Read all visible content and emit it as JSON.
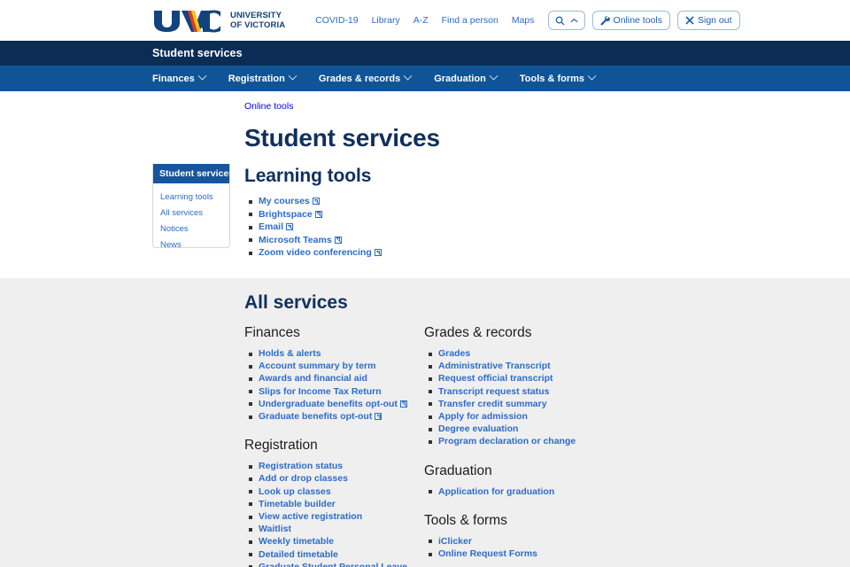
{
  "header": {
    "logo_text": "UVIC",
    "wordmark_line1": "UNIVERSITY",
    "wordmark_line2": "OF VICTORIA",
    "util_links": [
      {
        "label": "COVID-19"
      },
      {
        "label": "Library"
      },
      {
        "label": "A-Z"
      },
      {
        "label": "Find a person"
      },
      {
        "label": "Maps"
      }
    ],
    "search_button": {
      "icon": "search-icon",
      "chevron": "chevron-up-icon"
    },
    "online_tools_button": {
      "label": "Online tools",
      "icon": "wrench-icon"
    },
    "sign_out_button": {
      "label": "Sign out",
      "icon": "close-x-icon"
    }
  },
  "site_title": "Student services",
  "nav": {
    "items": [
      {
        "label": "Finances"
      },
      {
        "label": "Registration"
      },
      {
        "label": "Grades & records"
      },
      {
        "label": "Graduation"
      },
      {
        "label": "Tools & forms"
      }
    ]
  },
  "breadcrumb": "Online tools",
  "page_title": "Student services",
  "sidebar": {
    "heading": "Student services",
    "items": [
      {
        "label": "Learning tools"
      },
      {
        "label": "All services"
      },
      {
        "label": "Notices"
      },
      {
        "label": "News"
      }
    ]
  },
  "learning_tools": {
    "heading": "Learning tools",
    "items": [
      {
        "label": "My courses",
        "external": true
      },
      {
        "label": "Brightspace",
        "external": true
      },
      {
        "label": "Email",
        "external": true
      },
      {
        "label": "Microsoft Teams",
        "external": true
      },
      {
        "label": "Zoom video conferencing",
        "external": true
      }
    ]
  },
  "all_services": {
    "heading": "All services",
    "left_column": [
      {
        "category": "Finances",
        "items": [
          {
            "label": "Holds & alerts",
            "external": false
          },
          {
            "label": "Account summary by term",
            "external": false
          },
          {
            "label": "Awards and financial aid",
            "external": false
          },
          {
            "label": "Slips for Income Tax Return",
            "external": false
          },
          {
            "label": "Undergraduate benefits opt-out",
            "external": true
          },
          {
            "label": "Graduate benefits opt-out",
            "external": true
          }
        ]
      },
      {
        "category": "Registration",
        "items": [
          {
            "label": "Registration status",
            "external": false
          },
          {
            "label": "Add or drop classes",
            "external": false
          },
          {
            "label": "Look up classes",
            "external": false
          },
          {
            "label": "Timetable builder",
            "external": false
          },
          {
            "label": "View active registration",
            "external": false
          },
          {
            "label": "Waitlist",
            "external": false
          },
          {
            "label": "Weekly timetable",
            "external": false
          },
          {
            "label": "Detailed timetable",
            "external": false
          },
          {
            "label": "Graduate Student Personal Leave",
            "external": false
          }
        ]
      }
    ],
    "right_column": [
      {
        "category": "Grades & records",
        "items": [
          {
            "label": "Grades",
            "external": false
          },
          {
            "label": "Administrative Transcript",
            "external": false
          },
          {
            "label": "Request official transcript",
            "external": false
          },
          {
            "label": "Transcript request status",
            "external": false
          },
          {
            "label": "Transfer credit summary",
            "external": false
          },
          {
            "label": "Apply for admission",
            "external": false
          },
          {
            "label": "Degree evaluation",
            "external": false
          },
          {
            "label": "Program declaration or change",
            "external": false
          }
        ]
      },
      {
        "category": "Graduation",
        "items": [
          {
            "label": "Application for graduation",
            "external": false
          }
        ]
      },
      {
        "category": "Tools & forms",
        "items": [
          {
            "label": "iClicker",
            "external": false
          },
          {
            "label": "Online Request Forms",
            "external": false
          }
        ]
      }
    ]
  },
  "colors": {
    "navy": "#0b2c55",
    "nav_blue": "#0e5496",
    "link_blue": "#2d6cc7",
    "sidebar_head": "#16559c",
    "gray_bg": "#efefef",
    "heading_navy": "#10305e"
  }
}
